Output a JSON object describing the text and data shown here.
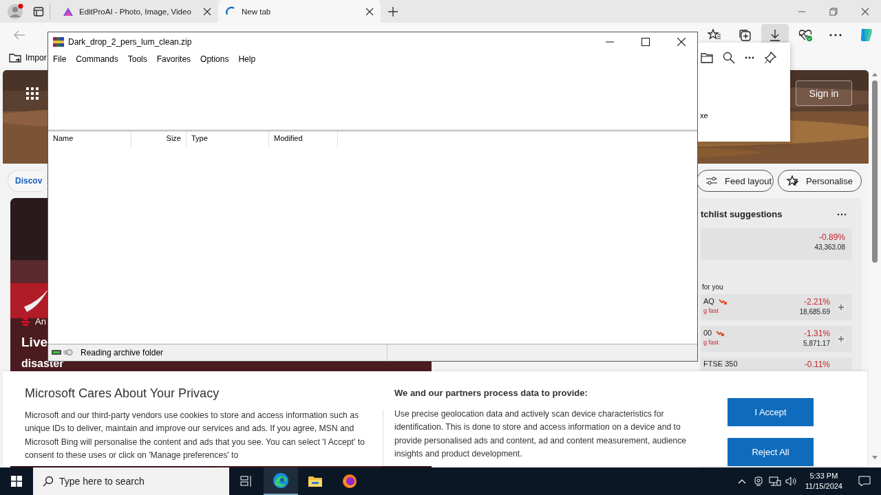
{
  "browser": {
    "tabs": [
      {
        "title": "EditProAI - Photo, Image, Video",
        "selected": false
      },
      {
        "title": "New tab",
        "selected": true
      }
    ],
    "favorites_bar": {
      "item": "Impor"
    },
    "downloads_panel": {
      "text": "xe"
    }
  },
  "msn": {
    "sign_in": "Sign in",
    "discover": "Discov",
    "feed_layout": "Feed layout",
    "personalise": "Personalise",
    "hero_story": {
      "source": "An",
      "headline_lines": [
        "Live",
        "disaster"
      ]
    },
    "watchlist": {
      "title": "tchlist suggestions",
      "top": {
        "change": "-0.89%",
        "value": "43,363.08"
      },
      "section": "for you",
      "rows": [
        {
          "name": "AQ",
          "note": "g fast",
          "change": "-2.21%",
          "value": "18,685.69"
        },
        {
          "name": "00",
          "note": "g fast",
          "change": "-1.31%",
          "value": "5,871.17"
        },
        {
          "name": "FTSE 350",
          "change": "-0.11%"
        }
      ]
    }
  },
  "archiver": {
    "title": "Dark_drop_2_pers_lum_clean.zip",
    "menu": [
      "File",
      "Commands",
      "Tools",
      "Favorites",
      "Options",
      "Help"
    ],
    "columns": [
      "Name",
      "Size",
      "Type",
      "Modified"
    ],
    "status": "Reading archive folder"
  },
  "consent": {
    "title": "Microsoft Cares About Your Privacy",
    "text": "Microsoft and our third-party vendors use cookies to store and access information such as unique IDs to deliver, maintain and improve our services and ads. If you agree, MSN and Microsoft Bing will personalise the content and ads that you see. You can select 'I Accept' to consent to these uses or click on 'Manage preferences' to",
    "purposes_title": "We and our partners process data to provide:",
    "purposes_text": "Use precise geolocation data and actively scan device characteristics for identification. This is done to store and access information on a device and to provide personalised ads and content, ad and content measurement, audience insights and product development.",
    "buttons": [
      "I Accept",
      "Reject All"
    ]
  },
  "taskbar": {
    "search_placeholder": "Type here to search",
    "time": "5:33 PM",
    "date": "11/15/2024"
  }
}
